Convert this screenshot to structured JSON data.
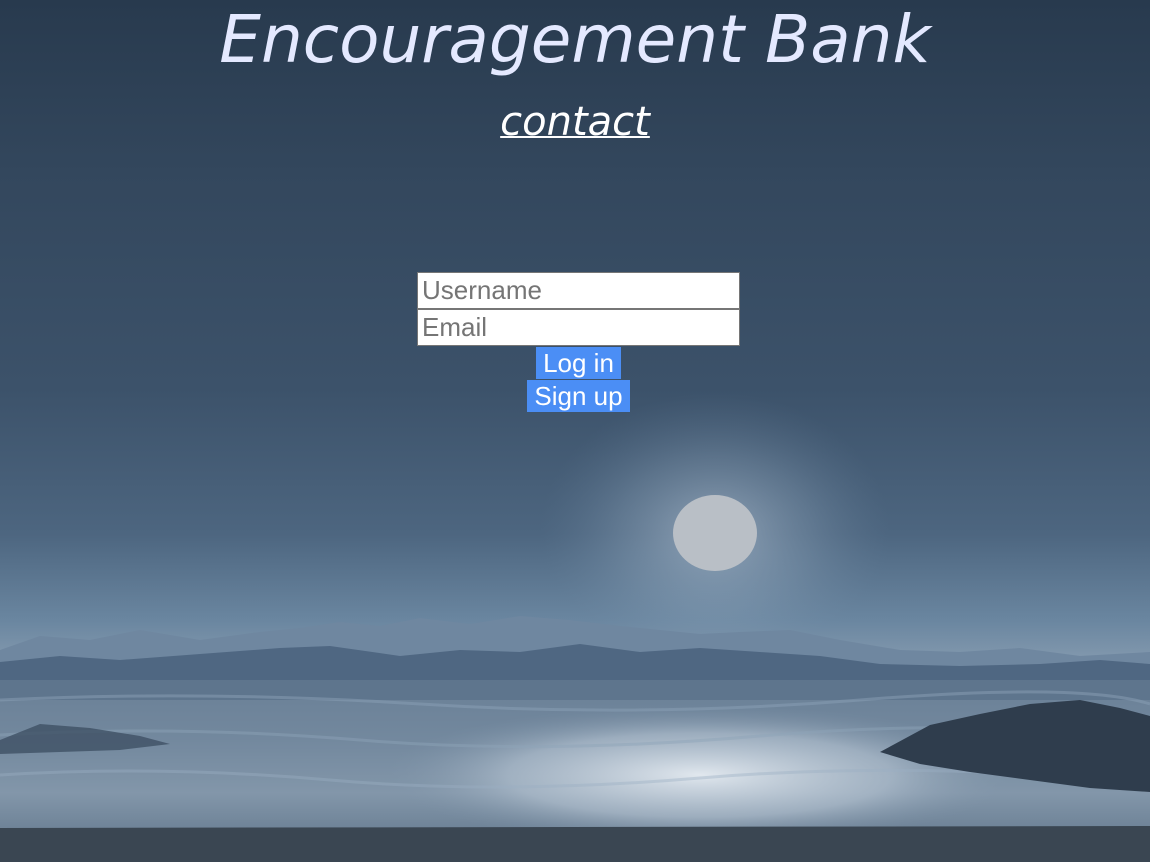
{
  "header": {
    "title": "Encouragement Bank",
    "contact_link": "contact"
  },
  "login_form": {
    "username_placeholder": "Username",
    "email_placeholder": "Email",
    "login_label": "Log in",
    "signup_label": "Sign up"
  },
  "colors": {
    "title_text": "#e4e9ff",
    "button_background": "#4b8ef5",
    "button_text": "#ffffff"
  }
}
